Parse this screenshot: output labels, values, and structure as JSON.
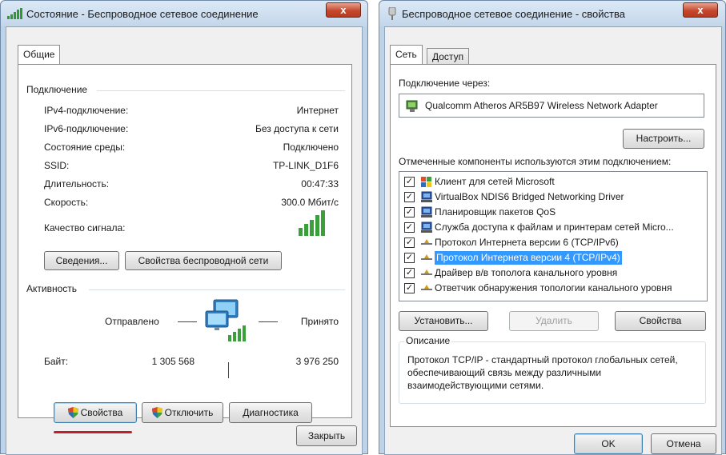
{
  "status_window": {
    "title": "Состояние - Беспроводное сетевое соединение",
    "close_glyph": "x",
    "tab": "Общие",
    "connection_group": "Подключение",
    "rows": [
      {
        "label": "IPv4-подключение:",
        "value": "Интернет"
      },
      {
        "label": "IPv6-подключение:",
        "value": "Без доступа к сети"
      },
      {
        "label": "Состояние среды:",
        "value": "Подключено"
      },
      {
        "label": "SSID:",
        "value": "TP-LINK_D1F6"
      },
      {
        "label": "Длительность:",
        "value": "00:47:33"
      },
      {
        "label": "Скорость:",
        "value": "300.0 Мбит/с"
      }
    ],
    "signal_label": "Качество сигнала:",
    "signal_bars": 5,
    "details_button": "Сведения...",
    "wireless_props_button": "Свойства беспроводной сети",
    "activity_group": "Активность",
    "sent_label": "Отправлено",
    "received_label": "Принято",
    "bytes_label": "Байт:",
    "bytes_sent": "1 305 568",
    "bytes_received": "3 976 250",
    "properties_button": "Свойства",
    "disable_button": "Отключить",
    "diagnose_button": "Диагностика",
    "close_button": "Закрыть",
    "highlight_color": "#c0202c"
  },
  "props_window": {
    "title": "Беспроводное сетевое соединение - свойства",
    "close_glyph": "x",
    "tabs": [
      "Сеть",
      "Доступ"
    ],
    "connect_using_label": "Подключение через:",
    "adapter": "Qualcomm Atheros AR5B97 Wireless Network Adapter",
    "configure_button": "Настроить...",
    "components_label": "Отмеченные компоненты используются этим подключением:",
    "components": [
      {
        "label": "Клиент для сетей Microsoft",
        "checked": true,
        "icon": "network-client-icon"
      },
      {
        "label": "VirtualBox NDIS6 Bridged Networking Driver",
        "checked": true,
        "icon": "network-service-icon"
      },
      {
        "label": "Планировщик пакетов QoS",
        "checked": true,
        "icon": "network-service-icon"
      },
      {
        "label": "Служба доступа к файлам и принтерам сетей Micro...",
        "checked": true,
        "icon": "network-service-icon"
      },
      {
        "label": "Протокол Интернета версии 6 (TCP/IPv6)",
        "checked": true,
        "icon": "protocol-icon"
      },
      {
        "label": "Протокол Интернета версии 4 (TCP/IPv4)",
        "checked": true,
        "icon": "protocol-icon",
        "selected": true
      },
      {
        "label": "Драйвер в/в тополога канального уровня",
        "checked": true,
        "icon": "protocol-icon"
      },
      {
        "label": "Ответчик обнаружения топологии канального уровня",
        "checked": true,
        "icon": "protocol-icon"
      }
    ],
    "install_button": "Установить...",
    "remove_button": "Удалить",
    "properties_button": "Свойства",
    "description_group": "Описание",
    "description": "Протокол TCP/IP - стандартный протокол глобальных сетей, обеспечивающий связь между различными взаимодействующими сетями.",
    "ok_button": "OK",
    "cancel_button": "Отмена",
    "selection_color": "#3399ff"
  }
}
